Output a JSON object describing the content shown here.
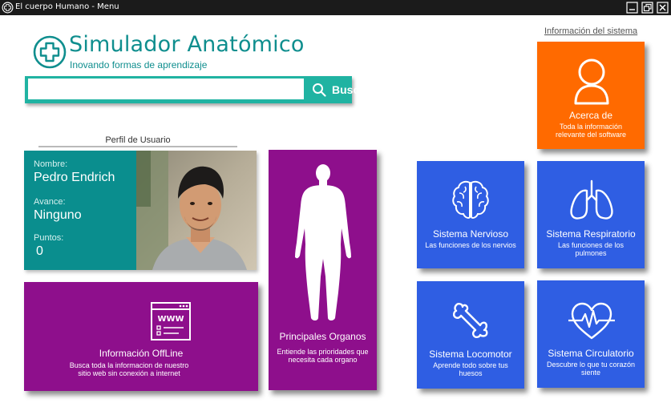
{
  "window": {
    "title": "El cuerpo Humano - Menu"
  },
  "header": {
    "title": "Simulador Anatómico",
    "subtitle": "Inovando formas de aprendizaje"
  },
  "search": {
    "placeholder": "",
    "value": "",
    "button_label": "Buscar"
  },
  "profile": {
    "section_label": "Perfil de Usuario",
    "name_label": "Nombre:",
    "name": "Pedro Endrich",
    "progress_label": "Avance:",
    "progress": "Ninguno",
    "points_label": "Puntos:",
    "points": "0"
  },
  "system_info": {
    "link_label": "Información del sistema"
  },
  "cards": {
    "offline": {
      "title": "Información OffLine",
      "description": "Busca toda la informacion de nuestro sitio web sin conexión a internet",
      "icon": "browser-www-icon"
    },
    "organs": {
      "title": "Principales Organos",
      "description": "Entiende las prioridades que necesita cada organo",
      "icon": "human-body-icon"
    },
    "about": {
      "title": "Acerca de",
      "description": "Toda la información relevante del software",
      "icon": "user-icon"
    },
    "nervous": {
      "title": "Sistema Nervioso",
      "description": "Las funciones de los nervios",
      "icon": "brain-icon"
    },
    "respiratory": {
      "title": "Sistema Respiratorio",
      "description": "Las funciones de los pulmones",
      "icon": "lungs-icon"
    },
    "locomotor": {
      "title": "Sistema Locomotor",
      "description": "Aprende todo sobre tus huesos",
      "icon": "bone-icon"
    },
    "circulatory": {
      "title": "Sistema Circulatorio",
      "description": "Descubre lo que tu corazón siente",
      "icon": "heart-pulse-icon"
    }
  },
  "colors": {
    "teal": "#0a8e8e",
    "search_teal": "#20b3a2",
    "purple": "#8e0f8c",
    "blue": "#2f5ee3",
    "orange": "#ff6a00"
  }
}
